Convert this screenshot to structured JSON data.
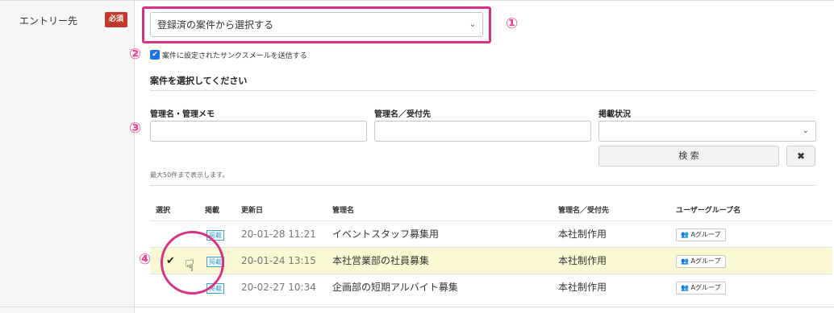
{
  "form": {
    "entry_label": "エントリー先",
    "required_badge": "必須",
    "entry_select_value": "登録済の案件から選択する",
    "thanks_mail_label": "案件に設定されたサンクスメールを送信する",
    "thanks_mail_checked": true
  },
  "annotations": {
    "n1": "①",
    "n2": "②",
    "n3": "③",
    "n4": "④"
  },
  "search": {
    "title": "案件を選択してください",
    "memo_label": "管理名・管理メモ",
    "dest_label": "管理名／受付先",
    "status_label": "掲載状況",
    "search_button": "検 索",
    "clear_button": "✖",
    "max_note": "最大50件まで表示します。"
  },
  "table": {
    "headers": [
      "選択",
      "掲載",
      "更新日",
      "管理名",
      "管理名／受付先",
      "ユーザーグループ名"
    ],
    "rows": [
      {
        "selected": false,
        "status": "掲載",
        "updated": "20-01-28 11:21",
        "name": "イベントスタッフ募集用",
        "dest": "本社制作用",
        "group": "Aグループ"
      },
      {
        "selected": true,
        "status": "掲載",
        "updated": "20-01-24 13:15",
        "name": "本社営業部の社員募集",
        "dest": "本社制作用",
        "group": "Aグループ"
      },
      {
        "selected": false,
        "status": "掲載",
        "updated": "20-02-27 10:34",
        "name": "企画部の短期アルバイト募集",
        "dest": "本社制作用",
        "group": "Aグループ"
      }
    ]
  },
  "colors": {
    "accent_pink": "#d63384",
    "required_red": "#c0392b",
    "selected_row": "#fbf9d4",
    "badge_blue": "#3ba3d0"
  },
  "icons": {
    "chevron": "chevron-down-icon",
    "group": "users-icon",
    "check": "checkmark-icon",
    "cursor": "hand-pointer-icon"
  }
}
